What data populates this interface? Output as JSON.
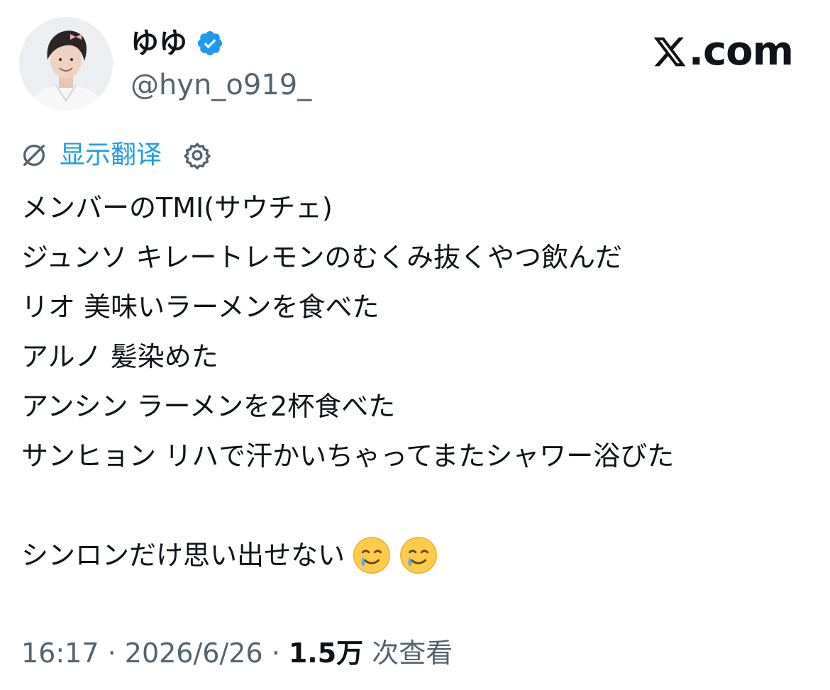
{
  "author": {
    "display_name": "ゆゆ",
    "handle": "@hyn_o919_",
    "verified": true
  },
  "brand": {
    "text": ".com"
  },
  "translate": {
    "label": "显示翻译"
  },
  "tweet": {
    "lines": [
      "メンバーのTMI(サウチェ)",
      "ジュンソ キレートレモンのむくみ抜くやつ飲んだ",
      "リオ 美味いラーメンを食べた",
      "アルノ 髪染めた",
      "アンシン ラーメンを2杯食べた",
      "サンヒョン リハで汗かいちゃってまたシャワー浴びた",
      "シンロンだけ思い出せない"
    ],
    "emojis": [
      "smiling-face-with-tear",
      "smiling-face-with-tear"
    ]
  },
  "meta": {
    "time": "16:17",
    "separator": " · ",
    "date": "2026/6/26",
    "views_count": "1.5万",
    "views_label": " 次查看"
  },
  "colors": {
    "accent": "#1d9bf0",
    "secondary_text": "#536471",
    "primary_text": "#0f1419"
  }
}
